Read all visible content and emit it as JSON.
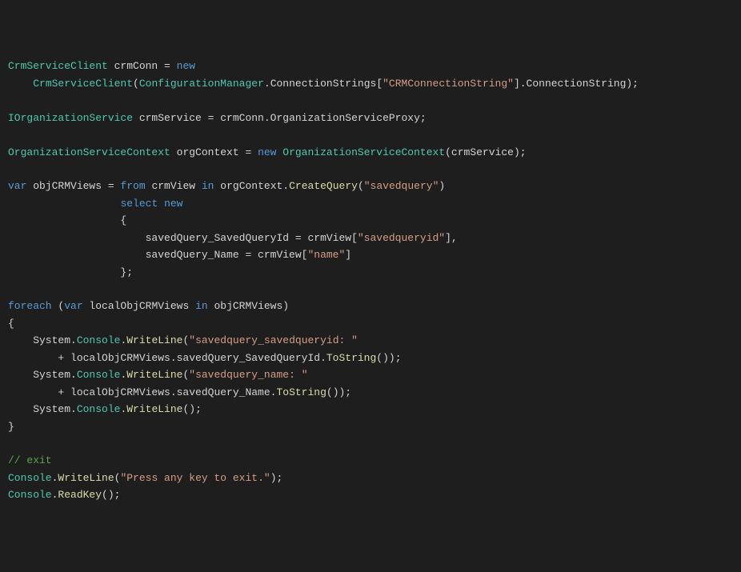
{
  "code": {
    "tokens": [
      [
        [
          "typ",
          "CrmServiceClient"
        ],
        [
          "pn",
          " crmConn "
        ],
        [
          "pn",
          "= "
        ],
        [
          "kw",
          "new"
        ]
      ],
      [
        [
          "pn",
          "    "
        ],
        [
          "typ",
          "CrmServiceClient"
        ],
        [
          "pn",
          "("
        ],
        [
          "typ",
          "ConfigurationManager"
        ],
        [
          "pn",
          ".ConnectionStrings["
        ],
        [
          "str",
          "\"CRMConnectionString\""
        ],
        [
          "pn",
          "].ConnectionString);"
        ]
      ],
      [],
      [
        [
          "typ",
          "IOrganizationService"
        ],
        [
          "pn",
          " crmService = crmConn.OrganizationServiceProxy;"
        ]
      ],
      [],
      [
        [
          "typ",
          "OrganizationServiceContext"
        ],
        [
          "pn",
          " orgContext = "
        ],
        [
          "kw",
          "new"
        ],
        [
          "pn",
          " "
        ],
        [
          "typ",
          "OrganizationServiceContext"
        ],
        [
          "pn",
          "(crmService);"
        ]
      ],
      [],
      [
        [
          "kw",
          "var"
        ],
        [
          "pn",
          " objCRMViews = "
        ],
        [
          "kw",
          "from"
        ],
        [
          "pn",
          " crmView "
        ],
        [
          "kw",
          "in"
        ],
        [
          "pn",
          " orgContext."
        ],
        [
          "id",
          "CreateQuery"
        ],
        [
          "pn",
          "("
        ],
        [
          "str",
          "\"savedquery\""
        ],
        [
          "pn",
          ")"
        ]
      ],
      [
        [
          "pn",
          "                  "
        ],
        [
          "kw",
          "select"
        ],
        [
          "pn",
          " "
        ],
        [
          "kw",
          "new"
        ]
      ],
      [
        [
          "pn",
          "                  {"
        ]
      ],
      [
        [
          "pn",
          "                      savedQuery_SavedQueryId = crmView["
        ],
        [
          "str",
          "\"savedqueryid\""
        ],
        [
          "pn",
          "],"
        ]
      ],
      [
        [
          "pn",
          "                      savedQuery_Name = crmView["
        ],
        [
          "str",
          "\"name\""
        ],
        [
          "pn",
          "]"
        ]
      ],
      [
        [
          "pn",
          "                  };"
        ]
      ],
      [],
      [
        [
          "kw",
          "foreach"
        ],
        [
          "pn",
          " ("
        ],
        [
          "kw",
          "var"
        ],
        [
          "pn",
          " localObjCRMViews "
        ],
        [
          "kw",
          "in"
        ],
        [
          "pn",
          " objCRMViews)"
        ]
      ],
      [
        [
          "pn",
          "{"
        ]
      ],
      [
        [
          "pn",
          "    System."
        ],
        [
          "typ",
          "Console"
        ],
        [
          "pn",
          "."
        ],
        [
          "id",
          "WriteLine"
        ],
        [
          "pn",
          "("
        ],
        [
          "str",
          "\"savedquery_savedqueryid: \""
        ]
      ],
      [
        [
          "pn",
          "        + localObjCRMViews.savedQuery_SavedQueryId."
        ],
        [
          "id",
          "ToString"
        ],
        [
          "pn",
          "());"
        ]
      ],
      [
        [
          "pn",
          "    System."
        ],
        [
          "typ",
          "Console"
        ],
        [
          "pn",
          "."
        ],
        [
          "id",
          "WriteLine"
        ],
        [
          "pn",
          "("
        ],
        [
          "str",
          "\"savedquery_name: \""
        ]
      ],
      [
        [
          "pn",
          "        + localObjCRMViews.savedQuery_Name."
        ],
        [
          "id",
          "ToString"
        ],
        [
          "pn",
          "());"
        ]
      ],
      [
        [
          "pn",
          "    System."
        ],
        [
          "typ",
          "Console"
        ],
        [
          "pn",
          "."
        ],
        [
          "id",
          "WriteLine"
        ],
        [
          "pn",
          "();"
        ]
      ],
      [
        [
          "pn",
          "}"
        ]
      ],
      [],
      [
        [
          "cm",
          "// exit"
        ]
      ],
      [
        [
          "typ",
          "Console"
        ],
        [
          "pn",
          "."
        ],
        [
          "id",
          "WriteLine"
        ],
        [
          "pn",
          "("
        ],
        [
          "str",
          "\"Press any key to exit.\""
        ],
        [
          "pn",
          ");"
        ]
      ],
      [
        [
          "typ",
          "Console"
        ],
        [
          "pn",
          "."
        ],
        [
          "id",
          "ReadKey"
        ],
        [
          "pn",
          "();"
        ]
      ]
    ]
  }
}
